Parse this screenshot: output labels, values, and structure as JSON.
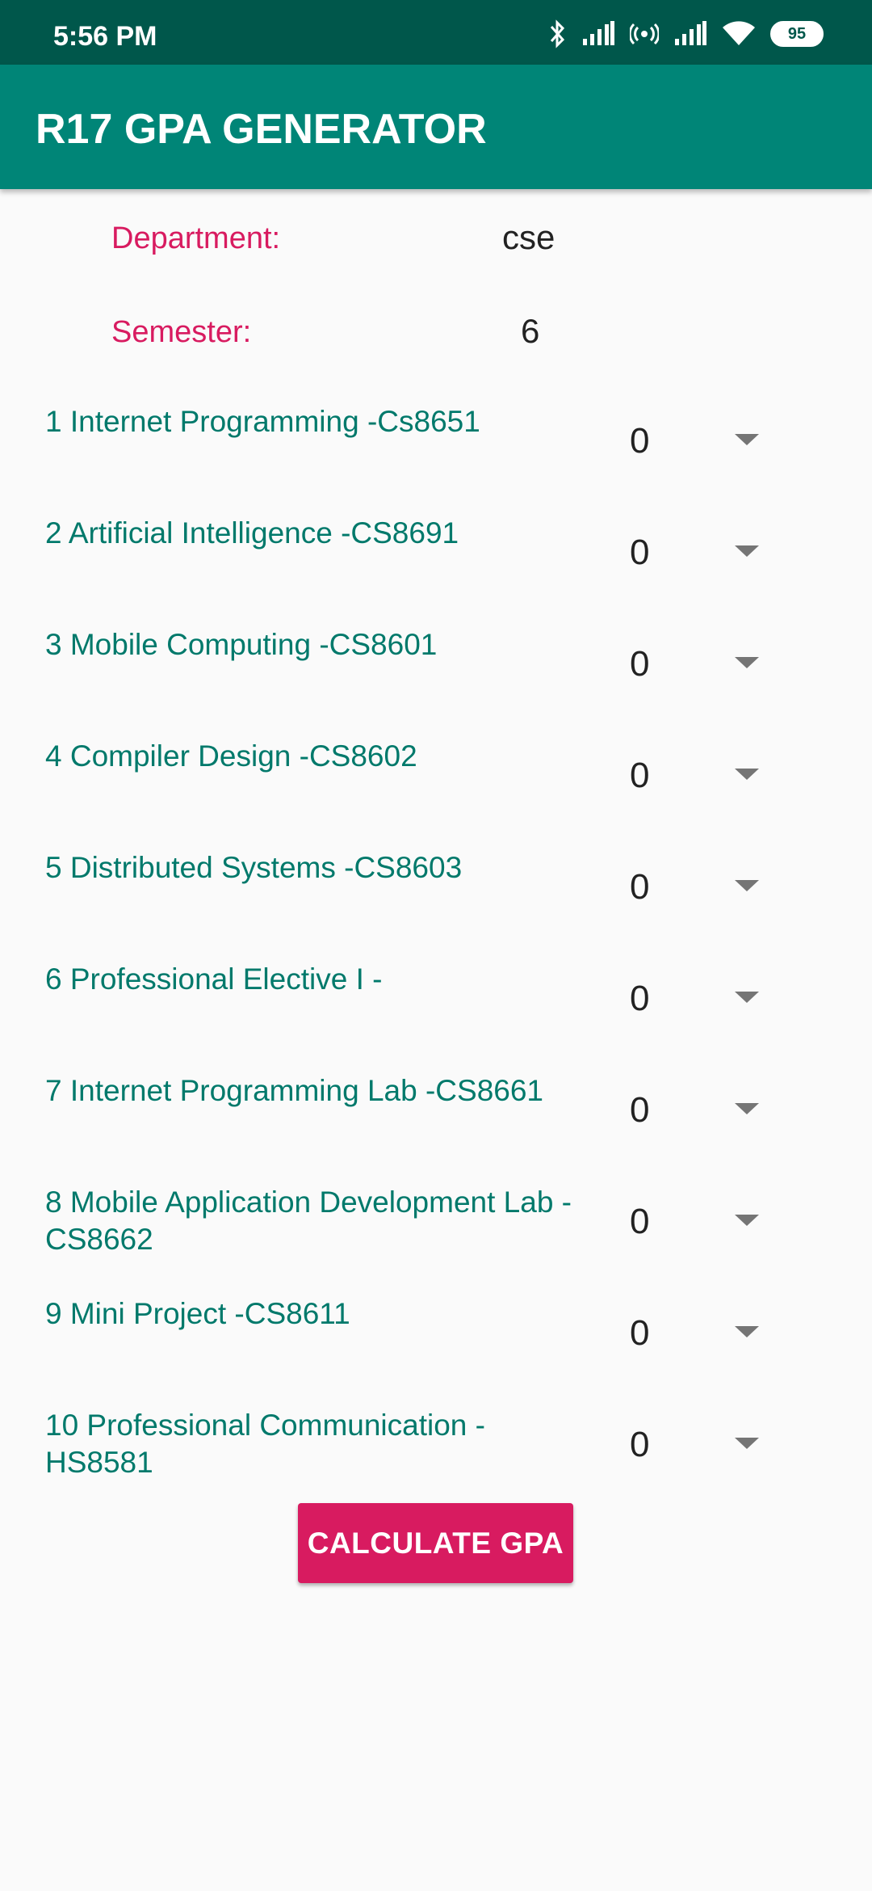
{
  "status_bar": {
    "time": "5:56 PM",
    "battery": "95"
  },
  "app_bar": {
    "title": "R17 GPA GENERATOR"
  },
  "info": {
    "department_label": "Department:",
    "department_value": "cse",
    "semester_label": "Semester:",
    "semester_value": "6"
  },
  "subjects": [
    {
      "name": "1 Internet Programming -Cs8651",
      "grade": "0"
    },
    {
      "name": "2 Artificial Intelligence -CS8691",
      "grade": "0"
    },
    {
      "name": "3 Mobile Computing -CS8601",
      "grade": "0"
    },
    {
      "name": "4 Compiler Design -CS8602",
      "grade": "0"
    },
    {
      "name": "5 Distributed Systems -CS8603",
      "grade": "0"
    },
    {
      "name": "6 Professional Elective I -",
      "grade": "0"
    },
    {
      "name": "7 Internet Programming Lab -CS8661",
      "grade": "0"
    },
    {
      "name": "8 Mobile Application Development Lab -CS8662",
      "grade": "0"
    },
    {
      "name": "9 Mini Project -CS8611",
      "grade": "0"
    },
    {
      "name": "10 Professional Communication -HS8581",
      "grade": "0"
    }
  ],
  "actions": {
    "calculate_label": "CALCULATE GPA"
  },
  "colors": {
    "status_bar": "#00574b",
    "app_bar": "#008577",
    "accent": "#d81b60",
    "subject_text": "#00796b"
  },
  "icons": [
    "bluetooth-icon",
    "signal-icon",
    "hotspot-icon",
    "wifi-icon",
    "battery-icon",
    "dropdown-arrow-icon"
  ]
}
